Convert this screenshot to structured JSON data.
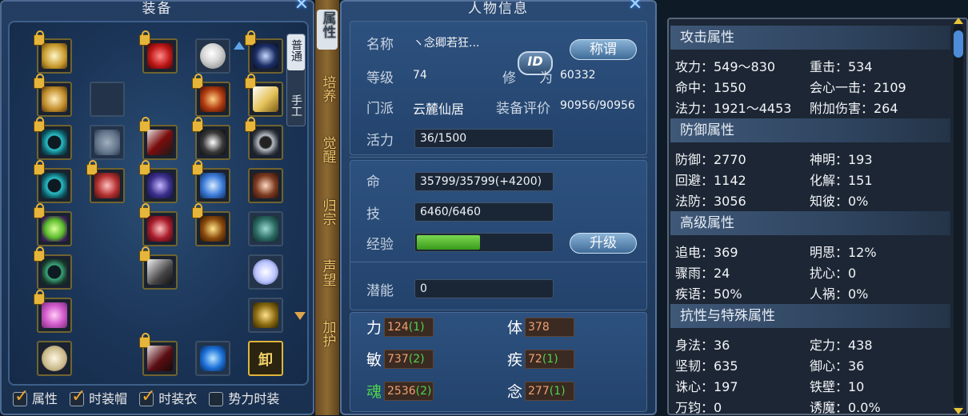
{
  "equip": {
    "title": "装备",
    "tabs": [
      "普通",
      "手工"
    ],
    "bottom_button": "卸",
    "checkboxes": [
      {
        "label": "属性",
        "checked": true
      },
      {
        "label": "时装帽",
        "checked": true
      },
      {
        "label": "时装衣",
        "checked": true
      },
      {
        "label": "势力时装",
        "checked": false
      }
    ]
  },
  "side_tabs": [
    "属性",
    "培养",
    "觉醒",
    "归宗",
    "声望",
    "加护"
  ],
  "char": {
    "title": "人物信息",
    "name_label": "名称",
    "name_value": "ヽ念卿若狂...",
    "id_button": "ID",
    "title_button": "称谓",
    "level_label": "等级",
    "level_value": "74",
    "xiu_label_1": "修",
    "xiu_label_2": "为",
    "xiu_value": "60332",
    "sect_label": "门派",
    "sect_value": "云麓仙居",
    "rating_label": "装备评价",
    "rating_value": "90956/90956",
    "vitality_label": "活力",
    "vitality_value": "36/1500",
    "hp_label": "命",
    "hp_value": "35799/35799(+4200)",
    "skill_label": "技",
    "skill_value": "6460/6460",
    "exp_label": "经验",
    "exp_fraction": 0.47,
    "levelup_button": "升级",
    "potential_label": "潜能",
    "potential_value": "0",
    "stats": [
      {
        "label": "力",
        "base": "124",
        "bonus": "(1)"
      },
      {
        "label": "体",
        "base": "378",
        "bonus": ""
      },
      {
        "label": "敏",
        "base": "737",
        "bonus": "(2)"
      },
      {
        "label": "疾",
        "base": "72",
        "bonus": "(1)"
      },
      {
        "label": "魂",
        "base": "2536",
        "bonus": "(2)"
      },
      {
        "label": "念",
        "base": "277",
        "bonus": "(1)"
      }
    ]
  },
  "attrs": {
    "sections": [
      {
        "header": "攻击属性",
        "rows": [
          [
            "攻力：549～830",
            "重击：534"
          ],
          [
            "命中：1550",
            "会心一击：2109"
          ],
          [
            "法力：1921～4453",
            "附加伤害：264"
          ]
        ]
      },
      {
        "header": "防御属性",
        "rows": [
          [
            "防御：2770",
            "神明：193"
          ],
          [
            "回避：1142",
            "化解：151"
          ],
          [
            "法防：3056",
            "知彼：0%"
          ]
        ]
      },
      {
        "header": "高级属性",
        "rows": [
          [
            "追电：369",
            "明思：12%"
          ],
          [
            "骤雨：24",
            "扰心：0"
          ],
          [
            "疾语：50%",
            "人祸：0%"
          ]
        ]
      },
      {
        "header": "抗性与特殊属性",
        "rows": [
          [
            "身法：36",
            "定力：438"
          ],
          [
            "坚韧：635",
            "御心：36"
          ],
          [
            "诛心：197",
            "铁壁：10"
          ],
          [
            "万钧：0",
            "诱魔：0.0%"
          ]
        ]
      }
    ]
  },
  "colors": {
    "accent_gold": "#f2c46b",
    "exp_bar": "#4fb52c",
    "bonus_green": "#4ed34e"
  }
}
